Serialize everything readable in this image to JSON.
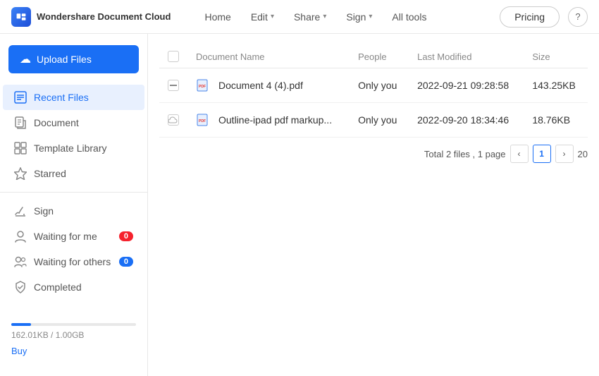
{
  "nav": {
    "logo_text": "Wondershare Document Cloud",
    "links": [
      {
        "label": "Home",
        "has_dropdown": false
      },
      {
        "label": "Edit",
        "has_dropdown": true
      },
      {
        "label": "Share",
        "has_dropdown": true
      },
      {
        "label": "Sign",
        "has_dropdown": true
      },
      {
        "label": "All tools",
        "has_dropdown": false
      }
    ],
    "pricing_label": "Pricing",
    "help_icon": "?"
  },
  "sidebar": {
    "upload_label": "Upload Files",
    "items": [
      {
        "id": "recent-files",
        "label": "Recent Files",
        "icon": "recent",
        "active": true,
        "badge": null
      },
      {
        "id": "document",
        "label": "Document",
        "icon": "document",
        "active": false,
        "badge": null
      },
      {
        "id": "template-library",
        "label": "Template Library",
        "icon": "template",
        "active": false,
        "badge": null
      },
      {
        "id": "starred",
        "label": "Starred",
        "icon": "star",
        "active": false,
        "badge": null
      },
      {
        "id": "sign",
        "label": "Sign",
        "icon": "sign",
        "active": false,
        "badge": null
      },
      {
        "id": "waiting-for-me",
        "label": "Waiting for me",
        "icon": "person",
        "active": false,
        "badge": "0",
        "badge_color": "red"
      },
      {
        "id": "waiting-for-others",
        "label": "Waiting for others",
        "icon": "persons",
        "active": false,
        "badge": "0",
        "badge_color": "blue"
      },
      {
        "id": "completed",
        "label": "Completed",
        "icon": "shield",
        "active": false,
        "badge": null
      }
    ],
    "storage_text": "162.01KB / 1.00GB",
    "buy_label": "Buy"
  },
  "table": {
    "columns": [
      "Document Name",
      "People",
      "Last Modified",
      "Size"
    ],
    "rows": [
      {
        "name": "Document 4 (4).pdf",
        "file_icon": "pdf",
        "people": "Only you",
        "last_modified": "2022-09-21 09:28:58",
        "size": "143.25KB",
        "cloud_icon": "dash"
      },
      {
        "name": "Outline-ipad pdf markup...",
        "file_icon": "pdf",
        "people": "Only you",
        "last_modified": "2022-09-20 18:34:46",
        "size": "18.76KB",
        "cloud_icon": "cloud"
      }
    ]
  },
  "pagination": {
    "summary": "Total 2 files , 1 page",
    "current_page": "1",
    "extra_page": "20"
  }
}
